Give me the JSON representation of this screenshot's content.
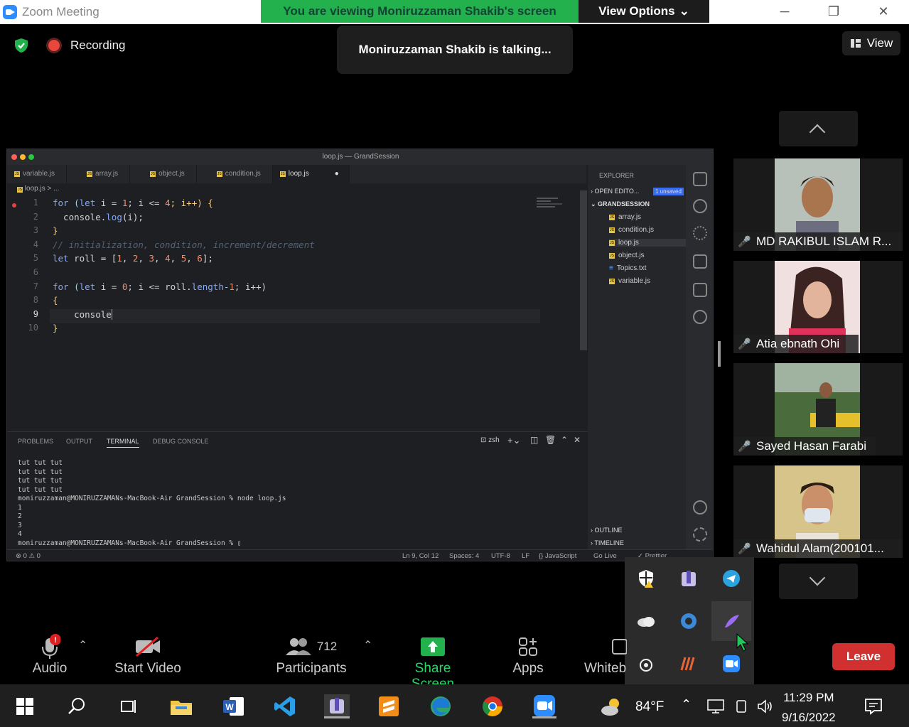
{
  "titlebar": {
    "app_title": "Zoom Meeting",
    "banner": "You are viewing Moniruzzaman Shakib's screen",
    "view_options": "View Options"
  },
  "top": {
    "recording": "Recording",
    "talking": "Moniruzzaman Shakib is talking...",
    "view": "View"
  },
  "vscode": {
    "window_title": "loop.js — GrandSession",
    "tabs": [
      "variable.js",
      "array.js",
      "object.js",
      "condition.js",
      "loop.js"
    ],
    "breadcrumb": "loop.js > ...",
    "lines": [
      "1",
      "2",
      "3",
      "4",
      "5",
      "6",
      "7",
      "8",
      "9",
      "10"
    ],
    "code": {
      "l1a": "for",
      "l1b": " (",
      "l1c": "let",
      "l1d": " i = ",
      "l1e": "1",
      "l1f": "; i <= ",
      "l1g": "4",
      "l1h": "; i++) {",
      "l2a": "  console.",
      "l2b": "log",
      "l2c": "(i);",
      "l3": "}",
      "l4": "// initialization, condition, increment/decrement",
      "l5a": "let",
      "l5b": " roll = [",
      "l5c": "1",
      "l5d": ", ",
      "l5e": "2",
      "l5f": ", ",
      "l5g": "3",
      "l5h": ", ",
      "l5i": "4",
      "l5j": ", ",
      "l5k": "5",
      "l5l": ", ",
      "l5m": "6",
      "l5n": "];",
      "l7a": "for",
      "l7b": " (",
      "l7c": "let",
      "l7d": " i = ",
      "l7e": "0",
      "l7f": "; i <= roll.",
      "l7g": "length",
      "l7h": "-",
      "l7i": "1",
      "l7j": "; i++)",
      "l8": "{",
      "l9": "    console",
      "l10": "}"
    },
    "panel_tabs": [
      "PROBLEMS",
      "OUTPUT",
      "TERMINAL",
      "DEBUG CONSOLE"
    ],
    "shell": "zsh",
    "terminal": "tut tut tut\ntut tut tut\ntut tut tut\ntut tut tut\nmoniruzzaman@MONIRUZZAMANs-MacBook-Air GrandSession % node loop.js\n1\n2\n3\n4\nmoniruzzaman@MONIRUZZAMANs-MacBook-Air GrandSession % ▯",
    "status_left": "⊗ 0 ⚠ 0",
    "status_right": [
      "Ln 9, Col 12",
      "Spaces: 4",
      "UTF-8",
      "LF",
      "{} JavaScript",
      "Go Live",
      "✓ Prettier"
    ],
    "explorer": {
      "title": "EXPLORER",
      "open_editors": "OPEN EDITO...",
      "unsaved": "1 unsaved",
      "folder": "GRANDSESSION",
      "files": [
        "array.js",
        "condition.js",
        "loop.js",
        "object.js",
        "Topics.txt",
        "variable.js"
      ],
      "outline": "OUTLINE",
      "timeline": "TIMELINE"
    }
  },
  "participants": [
    {
      "name": "MD RAKIBUL ISLAM R..."
    },
    {
      "name": "Atia ebnath Ohi"
    },
    {
      "name": "Sayed Hasan Farabi"
    },
    {
      "name": "Wahidul Alam(200101..."
    }
  ],
  "toolbar": {
    "audio": "Audio",
    "start_video": "Start Video",
    "participants": "Participants",
    "participant_count": "712",
    "share_screen": "Share Screen",
    "apps": "Apps",
    "whiteboard": "Whiteb",
    "leave": "Leave"
  },
  "taskbar": {
    "weather": "84°F",
    "time": "11:29 PM",
    "date": "9/16/2022"
  }
}
